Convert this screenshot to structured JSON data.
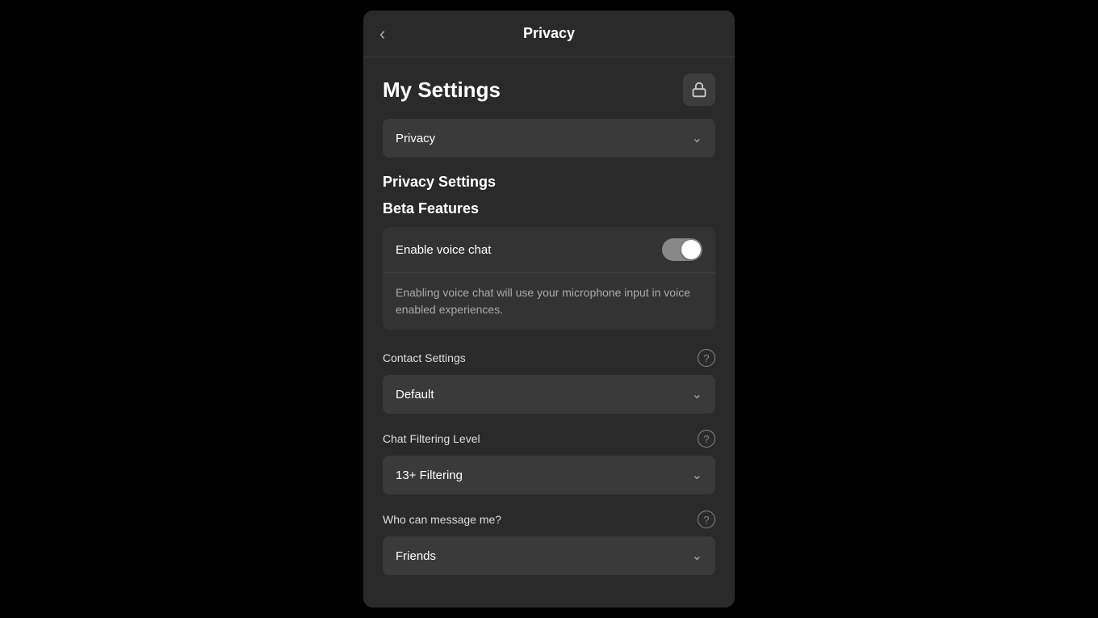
{
  "header": {
    "back_icon": "‹",
    "title": "Privacy"
  },
  "my_settings": {
    "title": "My Settings",
    "lock_icon": "🔒"
  },
  "category_dropdown": {
    "label": "Privacy",
    "arrow": "⌄"
  },
  "privacy_settings": {
    "heading": "Privacy Settings"
  },
  "beta_features": {
    "heading": "Beta Features",
    "toggle_label": "Enable voice chat",
    "toggle_state": "on",
    "description": "Enabling voice chat will use your microphone input in voice enabled experiences."
  },
  "contact_settings": {
    "heading": "Contact Settings",
    "dropdown_label": "Default",
    "dropdown_arrow": "⌄"
  },
  "chat_filtering": {
    "heading": "Chat Filtering Level",
    "dropdown_label": "13+ Filtering",
    "dropdown_arrow": "⌄"
  },
  "message_settings": {
    "heading": "Who can message me?",
    "dropdown_label": "Friends",
    "dropdown_arrow": "⌄"
  }
}
